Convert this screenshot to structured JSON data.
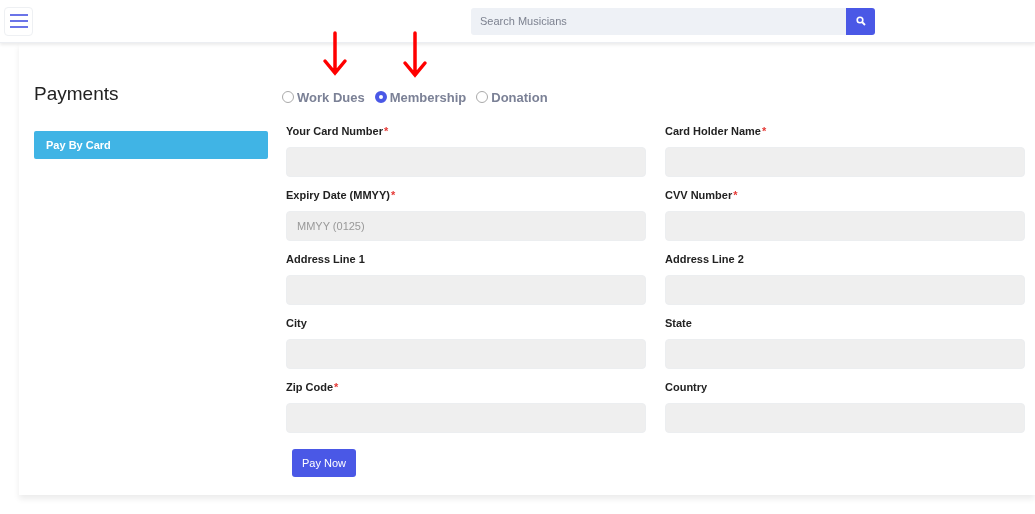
{
  "search": {
    "placeholder": "Search Musicians"
  },
  "title": "Payments",
  "sidebar": {
    "items": [
      {
        "label": "Pay By Card",
        "selected": true
      }
    ]
  },
  "payment_types": [
    {
      "label": "Work Dues",
      "selected": false
    },
    {
      "label": "Membership",
      "selected": true
    },
    {
      "label": "Donation",
      "selected": false
    }
  ],
  "fields": [
    {
      "label": "Your Card Number",
      "required_mark": "*"
    },
    {
      "label": "Card Holder Name",
      "required_mark": "*"
    },
    {
      "label": "Expiry Date (MMYY)",
      "required_mark": "*",
      "placeholder": "MMYY (0125)"
    },
    {
      "label": "CVV Number",
      "required_mark": "*"
    },
    {
      "label": "Address Line 1"
    },
    {
      "label": "Address Line 2"
    },
    {
      "label": "City"
    },
    {
      "label": "State"
    },
    {
      "label": "Zip Code",
      "required_mark": "*"
    },
    {
      "label": "Country"
    }
  ],
  "submit": "Pay Now"
}
